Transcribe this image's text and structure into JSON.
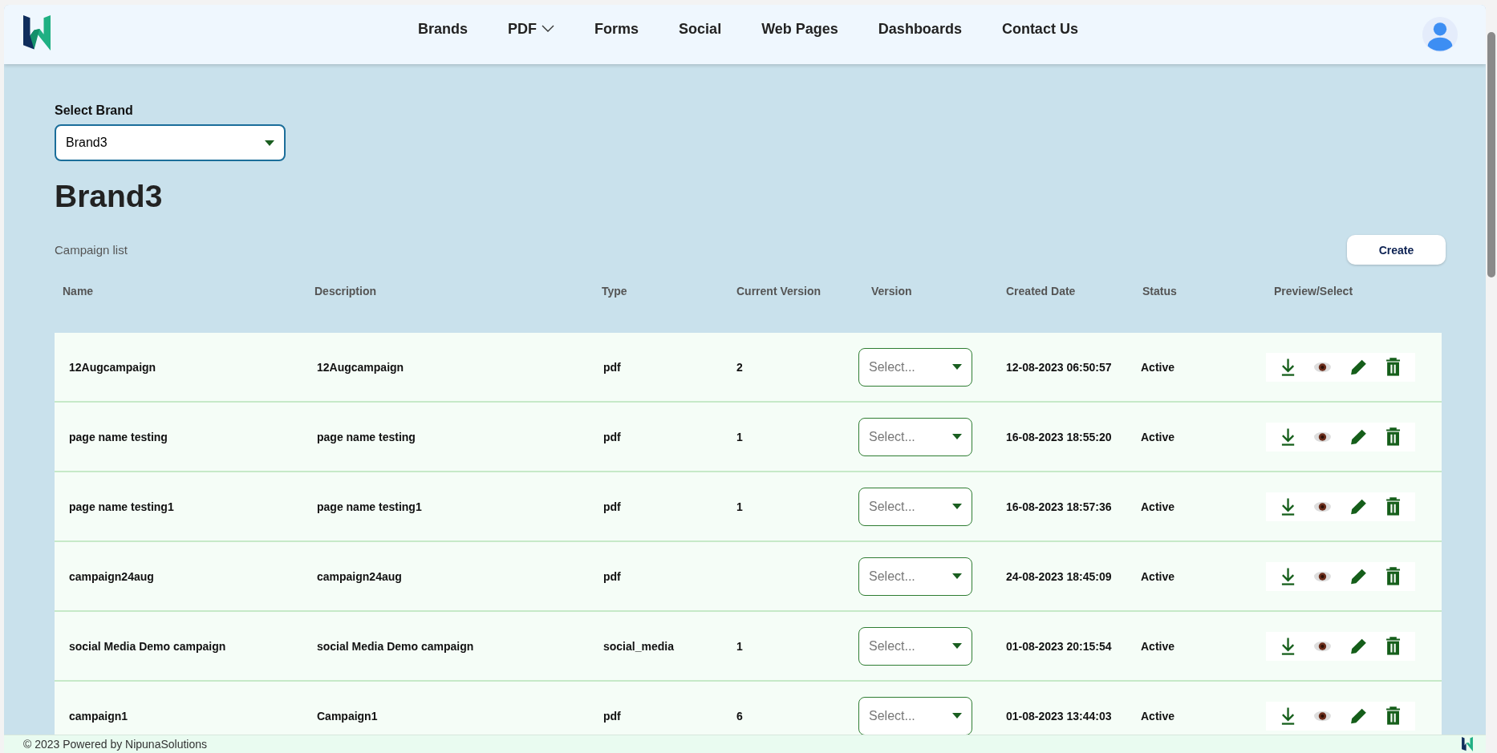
{
  "nav": [
    {
      "label": "Brands",
      "dropdown": false
    },
    {
      "label": "PDF",
      "dropdown": true
    },
    {
      "label": "Forms",
      "dropdown": false
    },
    {
      "label": "Social",
      "dropdown": false
    },
    {
      "label": "Web Pages",
      "dropdown": false
    },
    {
      "label": "Dashboards",
      "dropdown": false
    },
    {
      "label": "Contact Us",
      "dropdown": false
    }
  ],
  "brand_select": {
    "label": "Select Brand",
    "value": "Brand3"
  },
  "heading": "Brand3",
  "list_title": "Campaign list",
  "create_button": "Create",
  "table": {
    "columns": [
      "Name",
      "Description",
      "Type",
      "Current Version",
      "Version",
      "Created Date",
      "Status",
      "Preview/Select"
    ],
    "rows": [
      {
        "name": "12Augcampaign",
        "description": "12Augcampaign",
        "type": "pdf",
        "current_version": "2",
        "version_placeholder": "Select...",
        "created": "12-08-2023 06:50:57",
        "status": "Active"
      },
      {
        "name": "page name testing",
        "description": "page name testing",
        "type": "pdf",
        "current_version": "1",
        "version_placeholder": "Select...",
        "created": "16-08-2023 18:55:20",
        "status": "Active"
      },
      {
        "name": "page name testing1",
        "description": "page name testing1",
        "type": "pdf",
        "current_version": "1",
        "version_placeholder": "Select...",
        "created": "16-08-2023 18:57:36",
        "status": "Active"
      },
      {
        "name": "campaign24aug",
        "description": "campaign24aug",
        "type": "pdf",
        "version_placeholder": "Select...",
        "created": "24-08-2023 18:45:09",
        "status": "Active"
      },
      {
        "name": "social Media Demo campaign",
        "description": "social Media Demo campaign",
        "type": "social_media",
        "current_version": "1",
        "version_placeholder": "Select...",
        "created": "01-08-2023 20:15:54",
        "status": "Active"
      },
      {
        "name": "campaign1",
        "description": "Campaign1",
        "type": "pdf",
        "current_version": "6",
        "version_placeholder": "Select...",
        "created": "01-08-2023 13:44:03",
        "status": "Active"
      }
    ]
  },
  "footer": "© 2023 Powered by NipunaSolutions"
}
